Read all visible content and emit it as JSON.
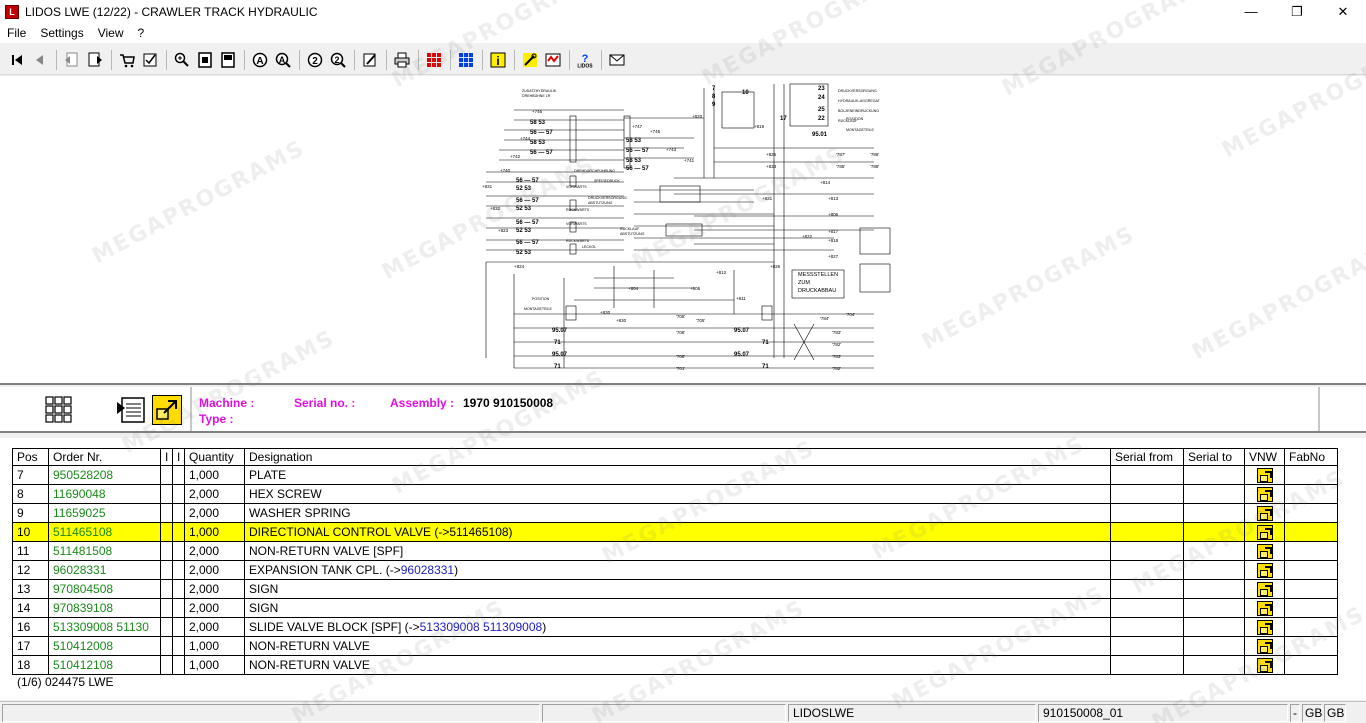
{
  "window": {
    "title": "LIDOS LWE (12/22) - CRAWLER TRACK HYDRAULIC",
    "app_icon_label": "L",
    "minimize": "—",
    "maximize": "❐",
    "close": "✕"
  },
  "menu": [
    "File",
    "Settings",
    "View",
    "?"
  ],
  "toolbar": {
    "icons": [
      "first-page-icon",
      "prev-page-icon",
      "doc-back-icon",
      "doc-forward-icon",
      "cart-icon",
      "checklist-icon",
      "zoom-in-icon",
      "page-icon",
      "page-fit-icon",
      "search-a-icon",
      "search-a2-icon",
      "search-2-icon",
      "search-22-icon",
      "edit-icon",
      "print-icon",
      "grid-red-icon",
      "grid-blue-icon",
      "info-icon",
      "tools-icon",
      "settings-icon",
      "help-icon",
      "mail-icon"
    ]
  },
  "drawing_labels": {
    "zusatz": "ZUSATZHYDRAULIK",
    "drehbuehne": "DREHBÜHNE LR",
    "drehdurch": "DREHDURCHFÜHRUNG",
    "speisedruck": "SPEISEDRUCK",
    "vorwaerts": "VORWÄRTS",
    "rueckwaerts": "RÜCKWÄRTS",
    "druckvers": "DRUCKVERSORGUNG",
    "abstuetzung": "ABSTÜTZUNG",
    "ruecklauf": "RÜCKLAUF",
    "leckoel": "LECKÖL",
    "position": "POSITION",
    "montagetiele": "MONTAGETEILE",
    "messstellen_1": "MESSSTELLEN",
    "messstellen_2": "ZUM",
    "messstellen_3": "DRUCKABBAU",
    "hydraulik_aggr": "HYDRAULIK-AGGREGAT",
    "bolzen": "BOLZENEINDRUCKUNG",
    "druckvers_r": "DRUCKVERSORGUNG",
    "n58_53": "58 53",
    "n56_57": "56 — 57",
    "n52_53": "52 53",
    "n95_01": "95.01",
    "n95_07": "95.07",
    "n71": "71",
    "n7": "7",
    "n8": "8",
    "n9": "9",
    "n10": "10",
    "n17": "17",
    "n22": "22",
    "n23": "23",
    "n24": "24",
    "n25": "25",
    "p746": "+746",
    "p747": "+747",
    "p744": "+744",
    "p745": "+745",
    "p742": "+742",
    "p743": "+743",
    "p740": "+740",
    "p741": "+741",
    "p831": "+831",
    "p832": "+832",
    "p823": "+823",
    "p824": "+824",
    "p820": "+820",
    "p819": "+819",
    "p825": "+825",
    "p833": "+833",
    "p814": "+814",
    "p821": "+821",
    "p806": "+806",
    "p822": "+822",
    "p817": "+817",
    "p818": "+818",
    "p827": "+827",
    "p826": "+826",
    "p812": "+812",
    "p804": "+804",
    "p805": "+805",
    "p811": "+811",
    "p830": "+830",
    "q787": "'787'",
    "q786": "'786'",
    "q785": "'785'",
    "q788": "'788'",
    "q784": "'784'",
    "q783": "'783'",
    "q782": "'782'",
    "q708": "'708'",
    "q705": "'705'",
    "q704": "'704'",
    "q781": "'781'",
    "q701": "'701'"
  },
  "infobar": {
    "machine_label": "Machine :",
    "type_label": "Type :",
    "serial_label": "Serial no. :",
    "assembly_label": "Assembly :",
    "assembly_value": "1970 910150008"
  },
  "table": {
    "headers": [
      "Pos",
      "Order Nr.",
      "I",
      "I",
      "Quantity",
      "Designation",
      "Serial from",
      "Serial to",
      "VNW",
      "FabNo"
    ],
    "rows": [
      {
        "pos": "7",
        "order": "950528208",
        "qty": "1,000",
        "desig": "PLATE",
        "link": ""
      },
      {
        "pos": "8",
        "order": "11690048",
        "qty": "2,000",
        "desig": "HEX SCREW",
        "link": ""
      },
      {
        "pos": "9",
        "order": "11659025",
        "qty": "2,000",
        "desig": "WASHER SPRING",
        "link": ""
      },
      {
        "pos": "10",
        "order": "511465108",
        "qty": "1,000",
        "desig": "DIRECTIONAL CONTROL VALVE (->511465108)",
        "link": "",
        "selected": true
      },
      {
        "pos": "11",
        "order": "511481508",
        "qty": "2,000",
        "desig": "NON-RETURN VALVE [SPF]",
        "link": ""
      },
      {
        "pos": "12",
        "order": "96028331",
        "qty": "2,000",
        "desig": "EXPANSION TANK CPL. (->",
        "link": "96028331",
        "tail": ")"
      },
      {
        "pos": "13",
        "order": "970804508",
        "qty": "2,000",
        "desig": "SIGN",
        "link": ""
      },
      {
        "pos": "14",
        "order": "970839108",
        "qty": "2,000",
        "desig": "SIGN",
        "link": ""
      },
      {
        "pos": "16",
        "order": "513309008 51130",
        "qty": "2,000",
        "desig": "SLIDE VALVE BLOCK [SPF] (->",
        "link": "513309008 511309008",
        "tail": ")"
      },
      {
        "pos": "17",
        "order": "510412008",
        "qty": "1,000",
        "desig": "NON-RETURN VALVE",
        "link": ""
      },
      {
        "pos": "18",
        "order": "510412108",
        "qty": "1,000",
        "desig": "NON-RETURN VALVE",
        "link": ""
      }
    ],
    "footer": "(1/6) 024475 LWE"
  },
  "statusbar": {
    "s1": "",
    "s2": "",
    "s3": "LIDOSLWE",
    "s4": "910150008_01",
    "s5": "-",
    "s6": "GB",
    "s7": "GB"
  },
  "watermark": "MEGAPROGRAMS",
  "colors": {
    "selected_row": "#ffff00",
    "order_number": "#1a8a1a",
    "link": "#2020c0",
    "label_magenta": "#e010e0"
  }
}
